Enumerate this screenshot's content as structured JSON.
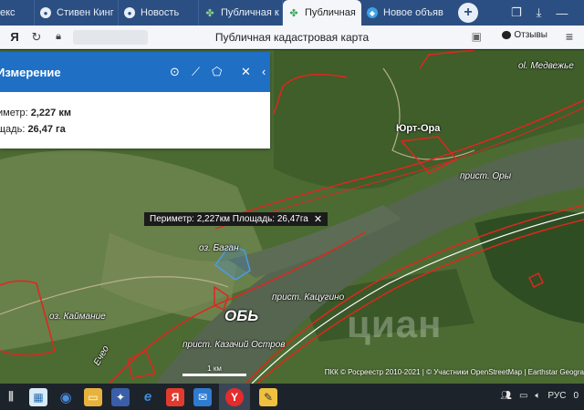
{
  "tabs": [
    {
      "label": "екс",
      "icon": "browser-tab-icon"
    },
    {
      "label": "Стивен Кинг",
      "icon": "web-icon"
    },
    {
      "label": "Новость",
      "icon": "web-icon"
    },
    {
      "label": "Публичная к",
      "icon": "map-icon"
    },
    {
      "label": "Публичная",
      "icon": "map-icon",
      "active": true
    },
    {
      "label": "Новое объяв",
      "icon": "ad-icon"
    }
  ],
  "address_bar": {
    "page_title": "Публичная кадастровая карта",
    "reviews_label": "Отзывы"
  },
  "measure_panel": {
    "title": "Измерение",
    "perimeter_label": "иметр:",
    "perimeter_value": "2,227 км",
    "area_label": "щадь:",
    "area_value": "26,47 га"
  },
  "tooltip": {
    "text": "Периметр: 2,227км Площадь: 26,47га"
  },
  "map": {
    "places": {
      "medvezhie": "ol. Медвежье",
      "yurt_ora": "Юрт-Ора",
      "prist_ory": "прист. Оры",
      "oz_bagan": "оз. Баган",
      "prist_kaigino": "прист. Кацугино",
      "ob": "ОБЬ",
      "prist_kazachiy": "прист. Казачий Остров",
      "oz_kaimanye": "оз. Каймание",
      "yeche": "Ечео"
    },
    "scale_label": "1 км",
    "attribution": "ПКК © Росреестр 2010-2021 | © Участники OpenStreetMap | Earthstar Geogra",
    "watermark": "циан"
  },
  "taskbar": {
    "clock": "0",
    "language": "РУС"
  },
  "colors": {
    "tab_strip": "#2b4f82",
    "panel_header": "#1f6fc4",
    "boundary": "#e0261f",
    "river": "#55654f"
  }
}
